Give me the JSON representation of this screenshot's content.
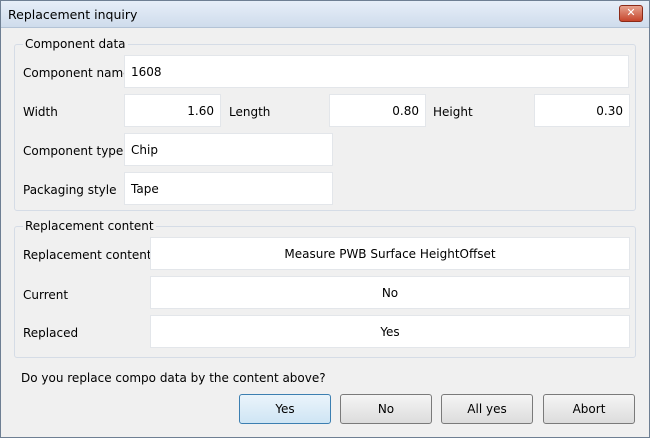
{
  "window": {
    "title": "Replacement inquiry",
    "close_label": "✕"
  },
  "component": {
    "group_title": "Component data",
    "name_label": "Component name",
    "name_value": "1608",
    "width_label": "Width",
    "width_value": "1.60",
    "length_label": "Length",
    "length_value": "0.80",
    "height_label": "Height",
    "height_value": "0.30",
    "type_label": "Component type",
    "type_value": "Chip",
    "packaging_label": "Packaging style",
    "packaging_value": "Tape"
  },
  "replacement": {
    "group_title": "Replacement content",
    "content_label": "Replacement content",
    "content_value": "Measure PWB Surface HeightOffset",
    "current_label": "Current",
    "current_value": "No",
    "replaced_label": "Replaced",
    "replaced_value": "Yes"
  },
  "prompt": "Do you replace compo data by the content above?",
  "buttons": {
    "yes": "Yes",
    "no": "No",
    "all_yes": "All yes",
    "abort": "Abort"
  }
}
